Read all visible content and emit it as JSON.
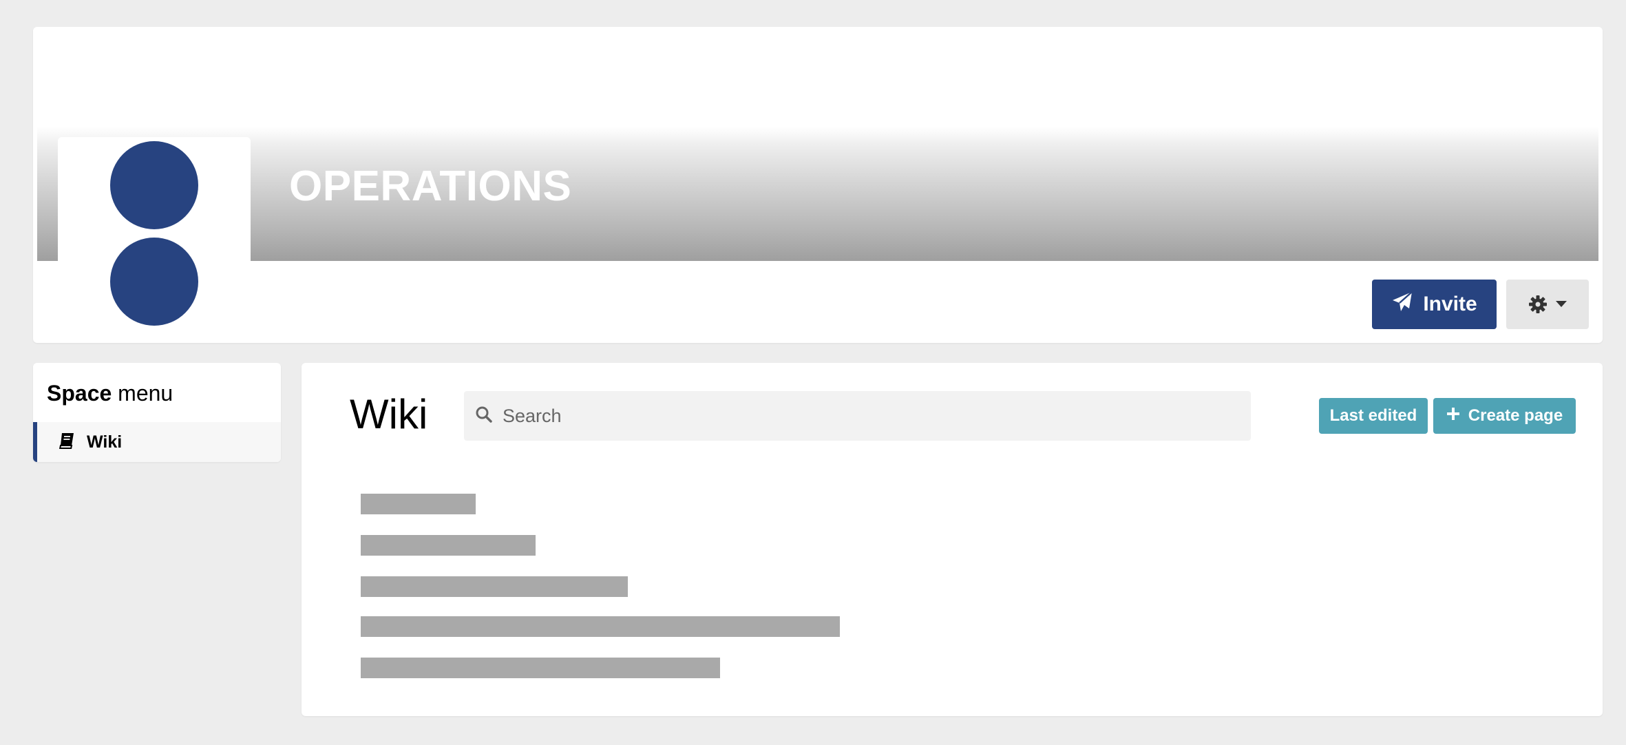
{
  "header": {
    "space_title": "OPERATIONS",
    "invite_label": "Invite",
    "brand_color": "#274380",
    "icons": {
      "invite": "paper-plane-icon",
      "settings": "gear-icon",
      "settings_caret": "caret-down-icon"
    }
  },
  "sidebar": {
    "heading_bold": "Space",
    "heading_rest": "menu",
    "items": [
      {
        "label": "Wiki",
        "icon": "book-icon",
        "active": true
      }
    ]
  },
  "main": {
    "title": "Wiki",
    "search": {
      "placeholder": "Search",
      "value": "",
      "icon": "search-icon"
    },
    "buttons": {
      "last_edited": "Last edited",
      "create_page": "Create page"
    },
    "accent_color": "#4fa3b5",
    "page_list_count": 5
  },
  "footer": {
    "text": ""
  }
}
